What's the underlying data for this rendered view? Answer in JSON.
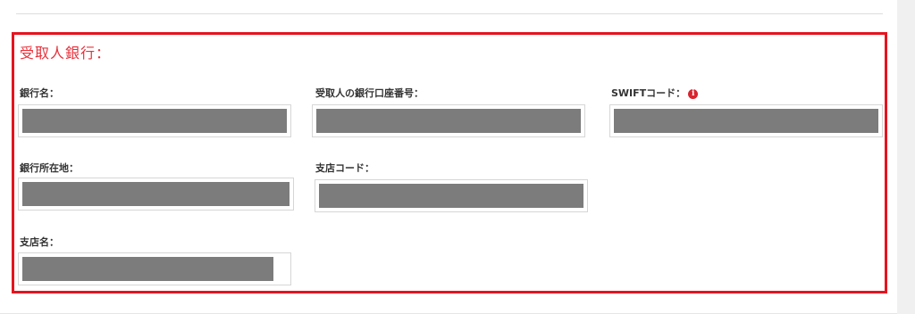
{
  "section": {
    "title": "受取人銀行："
  },
  "fields": {
    "bank_name": {
      "label": "銀行名：",
      "value": ""
    },
    "account_number": {
      "label": "受取人の銀行口座番号：",
      "value": ""
    },
    "swift_code": {
      "label": "SWIFTコード：",
      "info_icon": "info-icon",
      "value": ""
    },
    "bank_address": {
      "label": "銀行所在地：",
      "value": ""
    },
    "branch_code": {
      "label": "支店コード：",
      "value": ""
    },
    "branch_name": {
      "label": "支店名：",
      "value": ""
    }
  },
  "colors": {
    "highlight_border": "#e5141f",
    "title": "#e8303a",
    "redacted_fill": "#7c7c7c",
    "info_icon": "#d9232d"
  }
}
